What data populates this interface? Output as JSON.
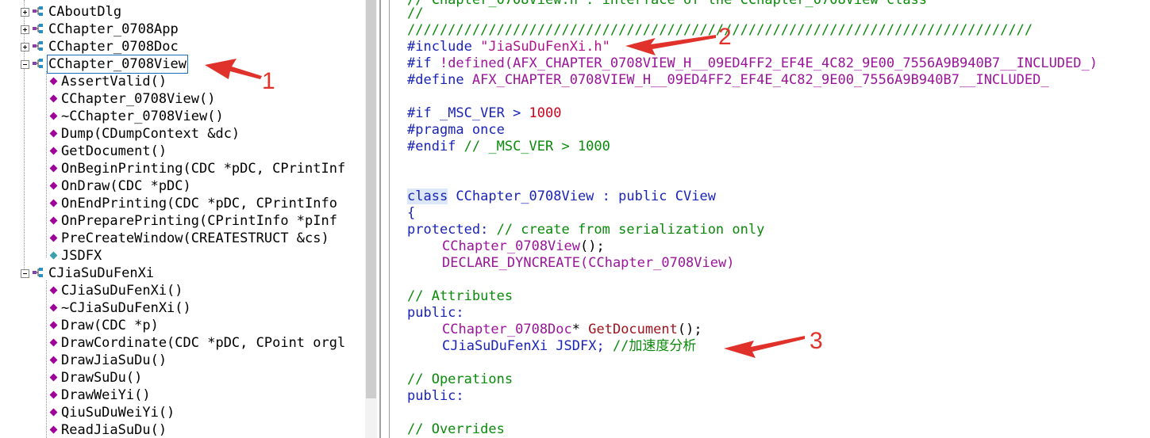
{
  "class_tree": {
    "top_items": [
      {
        "label": "CAboutDlg"
      },
      {
        "label": "CChapter_0708App"
      },
      {
        "label": "CChapter_0708Doc"
      },
      {
        "label": "CChapter_0708View"
      }
    ],
    "view_members": [
      {
        "label": "AssertValid()",
        "icon": "method-icon"
      },
      {
        "label": "CChapter_0708View()",
        "icon": "protected-method-icon"
      },
      {
        "label": "~CChapter_0708View()",
        "icon": "method-icon"
      },
      {
        "label": "Dump(CDumpContext &dc)",
        "icon": "method-icon"
      },
      {
        "label": "GetDocument()",
        "icon": "method-icon"
      },
      {
        "label": "OnBeginPrinting(CDC *pDC, CPrintInf",
        "icon": "protected-method-icon"
      },
      {
        "label": "OnDraw(CDC *pDC)",
        "icon": "method-icon"
      },
      {
        "label": "OnEndPrinting(CDC *pDC, CPrintInfo",
        "icon": "protected-method-icon"
      },
      {
        "label": "OnPreparePrinting(CPrintInfo *pInf",
        "icon": "protected-method-icon"
      },
      {
        "label": "PreCreateWindow(CREATESTRUCT &cs)",
        "icon": "method-icon"
      },
      {
        "label": "JSDFX",
        "icon": "member-variable-icon"
      }
    ],
    "second_class": {
      "label": "CJiaSuDuFenXi"
    },
    "second_members": [
      {
        "label": "CJiaSuDuFenXi()",
        "icon": "method-icon"
      },
      {
        "label": "~CJiaSuDuFenXi()",
        "icon": "method-icon"
      },
      {
        "label": "Draw(CDC *p)",
        "icon": "method-icon"
      },
      {
        "label": "DrawCordinate(CDC *pDC, CPoint orgl",
        "icon": "method-icon"
      },
      {
        "label": "DrawJiaSuDu()",
        "icon": "method-icon"
      },
      {
        "label": "DrawSuDu()",
        "icon": "method-icon"
      },
      {
        "label": "DrawWeiYi()",
        "icon": "method-icon"
      },
      {
        "label": "QiuSuDuWeiYi()",
        "icon": "method-icon"
      },
      {
        "label": "ReadJiaSuDu()",
        "icon": "method-icon"
      }
    ]
  },
  "code": {
    "line0": "// Chapter_0708View.h : interface of the CChapter_0708View class",
    "line1": "//",
    "line2": "/////////////////////////////////////////////////////////////////////////////",
    "include_kw": "#include",
    "include_file": "\"JiaSuDuFenXi.h\"",
    "if_kw": "#if",
    "if_rest": " !defined(AFX_CHAPTER_0708VIEW_H__09ED4FF2_EF4E_4C82_9E00_7556A9B940B7__INCLUDED_)",
    "define_kw": "#define",
    "define_rest": " AFX_CHAPTER_0708VIEW_H__09ED4FF2_EF4E_4C82_9E00_7556A9B940B7__INCLUDED_",
    "msc_kw": "#if",
    "msc_rest": " _MSC_VER > ",
    "msc_num": "1000",
    "pragma_kw": "#pragma",
    "pragma_rest": " once",
    "endif_kw": "#endif",
    "endif_comment": " // _MSC_VER > 1000",
    "class_kw": "class",
    "class_rest": " CChapter_0708View : public CView",
    "brace": "{",
    "protected_kw": "protected:",
    "protected_comment": " // create from serialization only",
    "ctor_name": "CChapter_0708View",
    "ctor_rest": "();",
    "dyncreate": "DECLARE_DYNCREATE",
    "dyncreate_rest": "(CChapter_0708View)",
    "attributes_comment": "// Attributes",
    "public_kw": "public:",
    "getdoc_type": "CChapter_0708Doc",
    "getdoc_star": "* ",
    "getdoc_name": "GetDocument",
    "getdoc_rest": "();",
    "member_type": "CJiaSuDuFenXi JSDFX;",
    "member_comment": " //加速度分析",
    "operations_comment": "// Operations",
    "public_kw2": "public:",
    "overrides_comment": "// Overrides"
  },
  "annotations": {
    "label1": "1",
    "label2": "2",
    "label3": "3",
    "color": "#e0322a"
  }
}
